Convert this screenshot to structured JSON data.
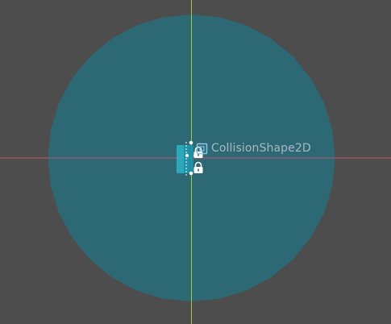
{
  "viewport": {
    "background_color": "#4d4d4d"
  },
  "axes": {
    "x_axis_color": "#c4556a",
    "y_axis_color": "#a6c93a"
  },
  "collision_shape": {
    "shape": "circle",
    "fill_color": "#2a6b78",
    "fill_opacity": 0.92
  },
  "node": {
    "name": "CollisionShape2D",
    "label_color": "#a9b7c3",
    "icon": "collision-shape-2d-icon",
    "icon_color": "#8ec5e6",
    "selection_color": "#2bb5c8"
  },
  "handles": [
    {
      "icon": "lock-icon"
    },
    {
      "icon": "lock-icon"
    }
  ]
}
